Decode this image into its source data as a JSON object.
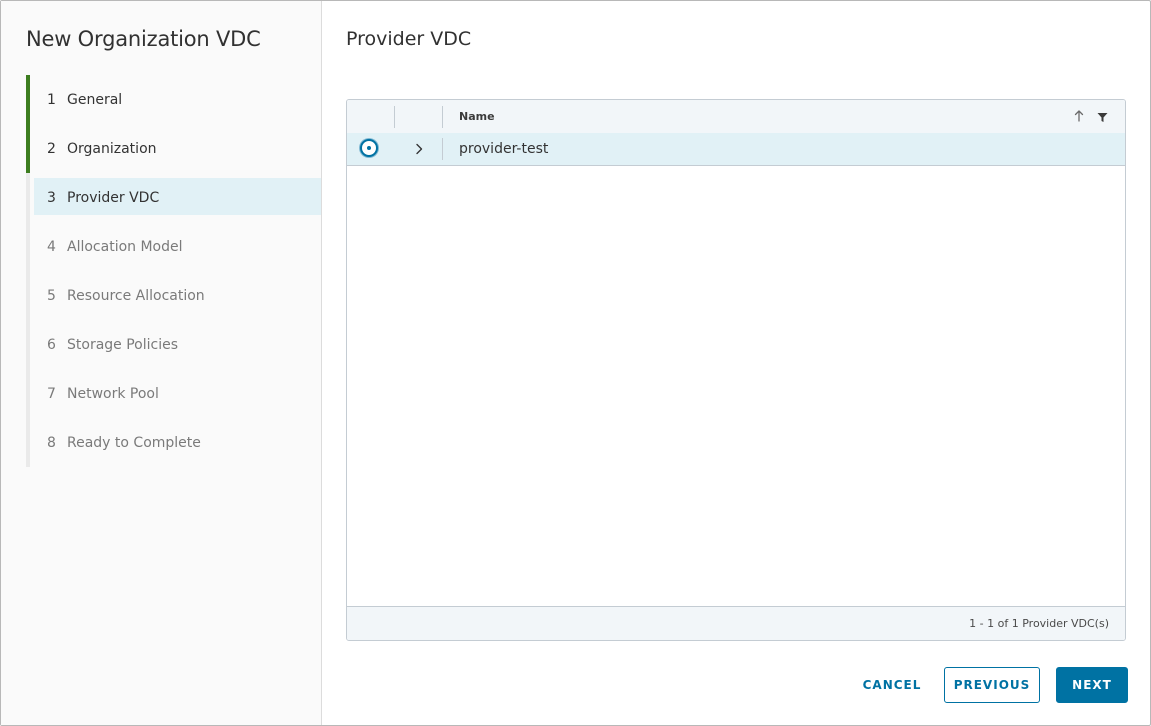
{
  "wizard": {
    "title": "New Organization VDC",
    "steps": [
      {
        "num": "1",
        "label": "General",
        "state": "done"
      },
      {
        "num": "2",
        "label": "Organization",
        "state": "done"
      },
      {
        "num": "3",
        "label": "Provider VDC",
        "state": "current"
      },
      {
        "num": "4",
        "label": "Allocation Model",
        "state": "pending"
      },
      {
        "num": "5",
        "label": "Resource Allocation",
        "state": "pending"
      },
      {
        "num": "6",
        "label": "Storage Policies",
        "state": "pending"
      },
      {
        "num": "7",
        "label": "Network Pool",
        "state": "pending"
      },
      {
        "num": "8",
        "label": "Ready to Complete",
        "state": "pending"
      }
    ]
  },
  "page": {
    "title": "Provider VDC"
  },
  "datagrid": {
    "columns": [
      "Name"
    ],
    "rows": [
      {
        "name": "provider-test",
        "selected": true
      }
    ],
    "footer_count": "1 - 1 of 1 Provider VDC(s)"
  },
  "buttons": {
    "cancel": "CANCEL",
    "previous": "PREVIOUS",
    "next": "NEXT"
  },
  "colors": {
    "accent": "#0072a3",
    "completed_step": "#3d7d1f",
    "selected_row": "#e1f1f6"
  },
  "icons": {
    "sort": "arrow-up-icon",
    "filter": "filter-icon",
    "expand": "chevron-right-icon"
  }
}
